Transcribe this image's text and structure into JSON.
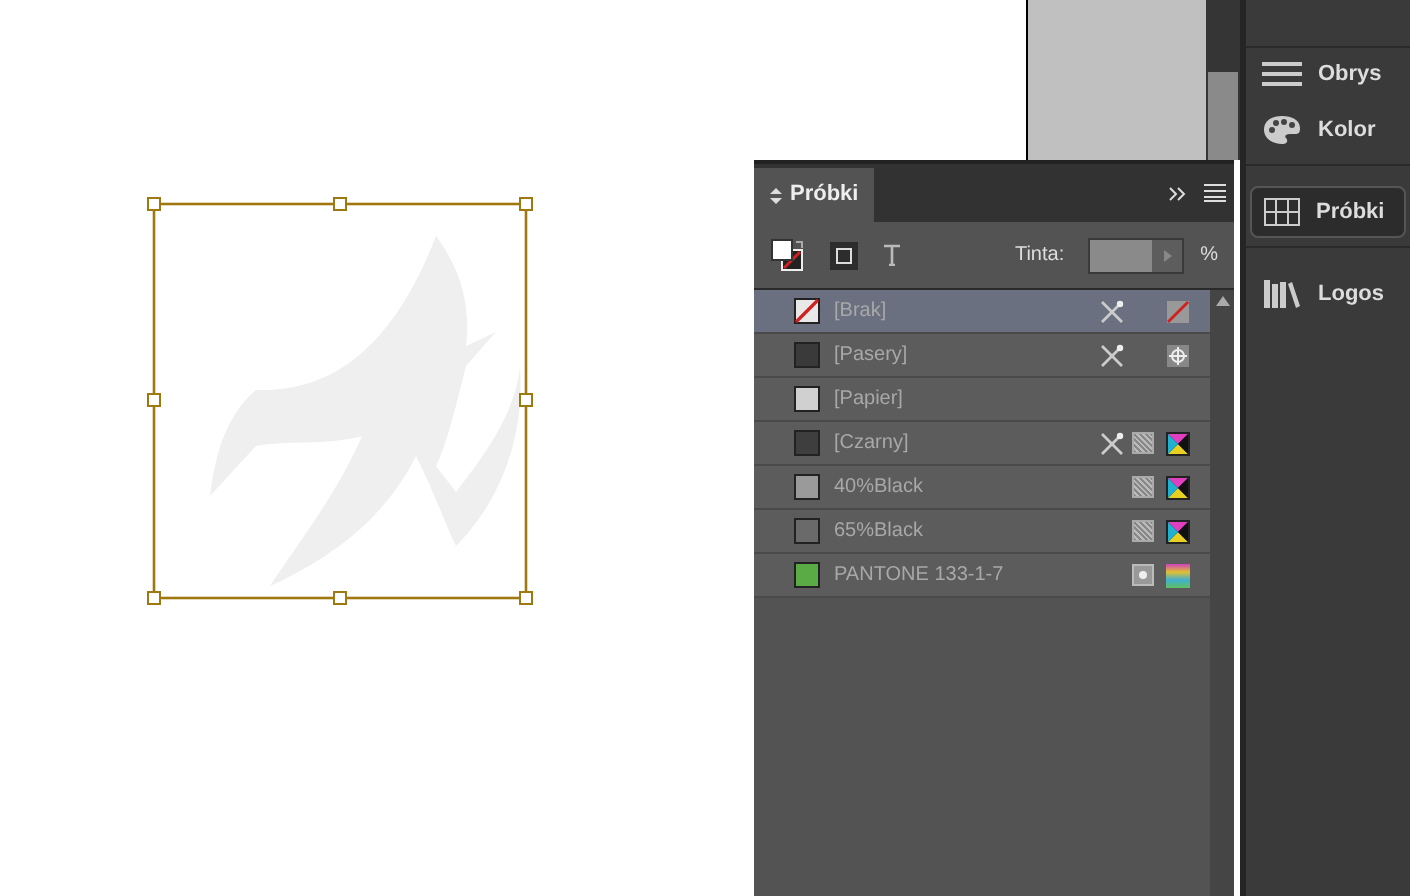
{
  "panel": {
    "tab": {
      "label": "Próbki",
      "selected": true
    },
    "tint_label": "Tinta:",
    "tint_unit": "%",
    "swatches": [
      {
        "name": "[Brak]",
        "kind": "none",
        "selected": true,
        "locked": true
      },
      {
        "name": "[Pasery]",
        "kind": "registration",
        "color": "#3a3a3a",
        "selected": false,
        "locked": true
      },
      {
        "name": "[Papier]",
        "kind": "paper",
        "color": "#d0d0d0",
        "selected": false,
        "locked": false
      },
      {
        "name": "[Czarny]",
        "kind": "process",
        "color": "#3e3e3e",
        "selected": false,
        "locked": true
      },
      {
        "name": "40%Black",
        "kind": "process",
        "color": "#9a9a9a",
        "selected": false,
        "locked": false
      },
      {
        "name": "65%Black",
        "kind": "process",
        "color": "#6a6a6a",
        "selected": false,
        "locked": false
      },
      {
        "name": "PANTONE 133-1-7",
        "kind": "spot",
        "color": "#5aaa45",
        "selected": false,
        "locked": false
      }
    ]
  },
  "dock_groups": [
    [
      {
        "label": "Obrys",
        "kind": "stroke",
        "selected": false
      },
      {
        "label": "Kolor",
        "kind": "color",
        "selected": false
      }
    ],
    [
      {
        "label": "Próbki",
        "kind": "swatches",
        "selected": true
      }
    ],
    [
      {
        "label": "Logos",
        "kind": "library",
        "selected": false
      }
    ]
  ]
}
